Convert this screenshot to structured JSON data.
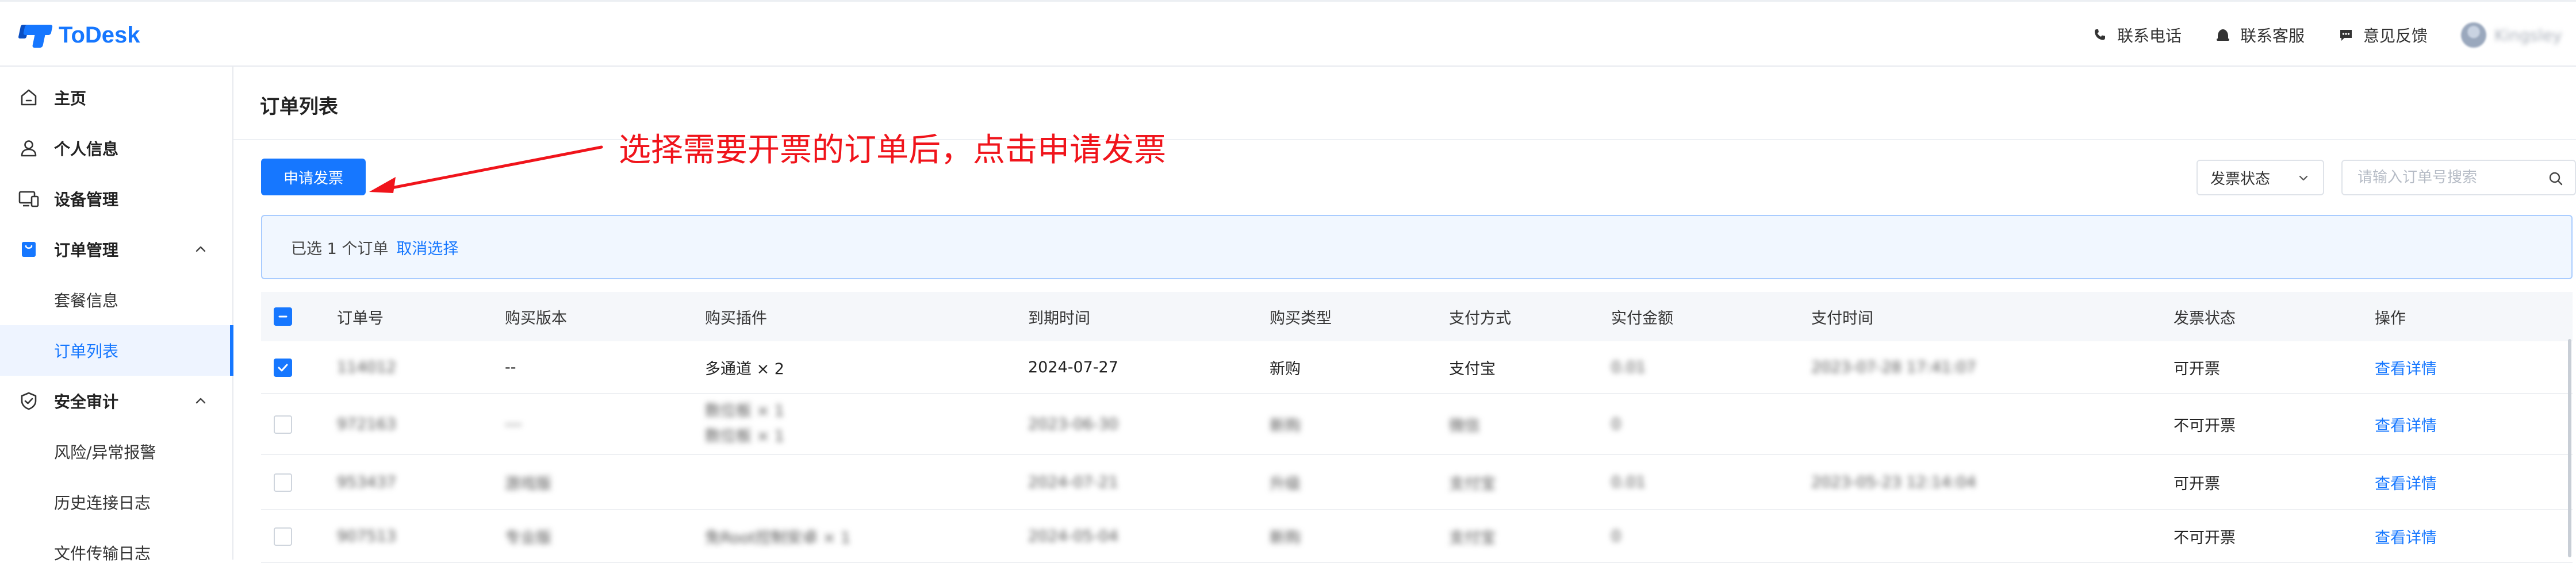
{
  "header": {
    "logo_text": "ToDesk",
    "links": [
      {
        "label": "联系电话",
        "icon": "phone-icon"
      },
      {
        "label": "联系客服",
        "icon": "headset-icon"
      },
      {
        "label": "意见反馈",
        "icon": "feedback-icon"
      }
    ],
    "username": "Kingsley"
  },
  "sidebar": {
    "items": [
      {
        "label": "主页",
        "icon": "home-icon"
      },
      {
        "label": "个人信息",
        "icon": "user-icon"
      },
      {
        "label": "设备管理",
        "icon": "devices-icon"
      },
      {
        "label": "订单管理",
        "icon": "order-bag-icon",
        "expanded": true
      },
      {
        "label": "套餐信息"
      },
      {
        "label": "订单列表",
        "active": true
      },
      {
        "label": "安全审计",
        "icon": "shield-icon",
        "expanded": true
      },
      {
        "label": "风险/异常报警"
      },
      {
        "label": "历史连接日志"
      },
      {
        "label": "文件传输日志"
      }
    ]
  },
  "main": {
    "title": "订单列表",
    "apply_button": "申请发票",
    "annotation": "选择需要开票的订单后，点击申请发票",
    "status_filter": "发票状态",
    "search_placeholder": "请输入订单号搜索",
    "selection_text": "已选 1 个订单",
    "cancel_selection": "取消选择"
  },
  "table": {
    "columns": [
      "订单号",
      "购买版本",
      "购买插件",
      "到期时间",
      "购买类型",
      "支付方式",
      "实付金额",
      "支付时间",
      "发票状态",
      "操作"
    ],
    "rows": [
      {
        "checked": true,
        "order_no": "114012",
        "version": "--",
        "plugins": [
          "多通道 × 2"
        ],
        "expire": "2024-07-27",
        "type": "新购",
        "pay": "支付宝",
        "amount": "0.01",
        "time": "2023-07-28 17:41:07",
        "invoice": "可开票",
        "action": "查看详情",
        "blurred": [
          "order_no",
          "amount",
          "time"
        ]
      },
      {
        "checked": false,
        "order_no": "972163",
        "version": "---",
        "plugins": [
          "数位板 × 1",
          "数位板 × 1"
        ],
        "expire": "2023-06-30",
        "type": "新购",
        "pay": "微信",
        "amount": "0",
        "time": "",
        "invoice": "不可开票",
        "action": "查看详情",
        "blurred": [
          "order_no",
          "version",
          "plugins",
          "expire",
          "type",
          "pay",
          "amount"
        ]
      },
      {
        "checked": false,
        "order_no": "953437",
        "version": "游戏版",
        "plugins": [],
        "expire": "2024-07-21",
        "type": "升级",
        "pay": "支付宝",
        "amount": "0.01",
        "time": "2023-05-23 12:14:04",
        "invoice": "可开票",
        "action": "查看详情",
        "blurred": [
          "order_no",
          "version",
          "expire",
          "type",
          "pay",
          "amount",
          "time"
        ]
      },
      {
        "checked": false,
        "order_no": "907513",
        "version": "专业版",
        "plugins": [
          "免Root控制安卓 × 1"
        ],
        "expire": "2024-05-04",
        "type": "新购",
        "pay": "支付宝",
        "amount": "0",
        "time": "",
        "invoice": "不可开票",
        "action": "查看详情",
        "blurred": [
          "order_no",
          "version",
          "plugins",
          "expire",
          "type",
          "pay",
          "amount"
        ]
      }
    ]
  },
  "colors": {
    "accent": "#1677ff",
    "annotation": "#f0141b"
  }
}
